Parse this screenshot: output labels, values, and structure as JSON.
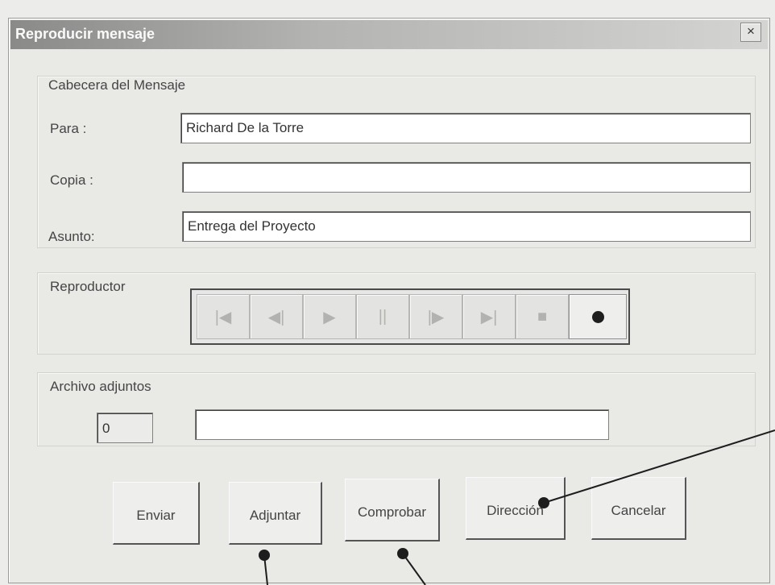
{
  "window": {
    "title": "Reproducir mensaje",
    "close_label": "×"
  },
  "header_group": {
    "label": "Cabecera del Mensaje",
    "para": {
      "label": "Para :",
      "value": "Richard De la Torre"
    },
    "copia": {
      "label": "Copia :",
      "value": ""
    },
    "asunto": {
      "label": "Asunto:",
      "value": "Entrega del Proyecto"
    }
  },
  "player": {
    "label": "Reproductor",
    "buttons": [
      {
        "icon": "skip-to-start-icon",
        "glyph": "|◀"
      },
      {
        "icon": "step-back-icon",
        "glyph": "◀|"
      },
      {
        "icon": "play-icon",
        "glyph": "▶"
      },
      {
        "icon": "pause-icon",
        "glyph": "||"
      },
      {
        "icon": "step-forward-icon",
        "glyph": "|▶"
      },
      {
        "icon": "skip-to-end-icon",
        "glyph": "▶|"
      },
      {
        "icon": "stop-icon",
        "glyph": "■"
      },
      {
        "icon": "record-icon",
        "glyph": "●"
      }
    ]
  },
  "attachments": {
    "label": "Archivo adjuntos",
    "count": "0",
    "file": ""
  },
  "buttons": {
    "enviar": "Enviar",
    "adjuntar": "Adjuntar",
    "comprobar": "Comprobar",
    "direccion": "Dirección",
    "cancelar": "Cancelar"
  }
}
